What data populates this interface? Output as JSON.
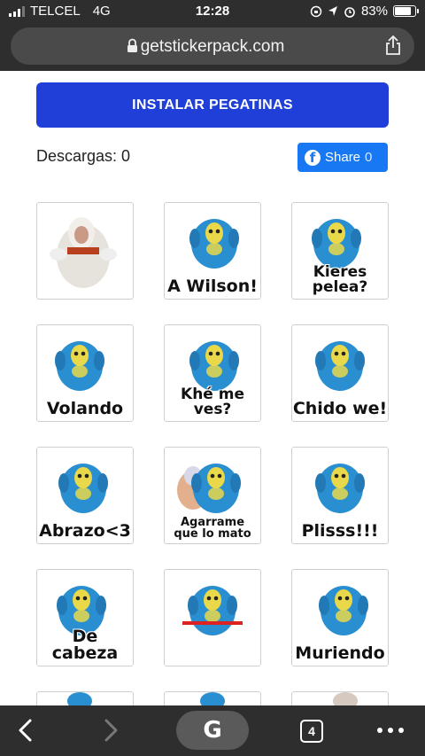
{
  "status_bar": {
    "carrier": "TELCEL",
    "network": "4G",
    "time": "12:28",
    "battery": "83%",
    "battery_level": 0.83
  },
  "browser": {
    "url": "getstickerpack.com",
    "tab_count": "4",
    "home_label": "G"
  },
  "page": {
    "install_button": "INSTALAR PEGATINAS",
    "downloads_label": "Descargas: 0",
    "share_label": "Share",
    "share_count": "0"
  },
  "stickers": [
    {
      "caption": ""
    },
    {
      "caption": "A Wilson!"
    },
    {
      "caption": "Kieres pelea?"
    },
    {
      "caption": "Volando"
    },
    {
      "caption": "Khé me ves?"
    },
    {
      "caption": "Chido we!"
    },
    {
      "caption": "Abrazo<3"
    },
    {
      "caption": "Agarrame que lo mato"
    },
    {
      "caption": "Plisss!!!"
    },
    {
      "caption": "De cabeza"
    },
    {
      "caption": ""
    },
    {
      "caption": "Muriendo"
    }
  ],
  "colors": {
    "install_button": "#1f3fd8",
    "facebook": "#1877f2",
    "mascot_blue": "#2a8fd0",
    "mascot_yellow": "#e8d84a"
  }
}
